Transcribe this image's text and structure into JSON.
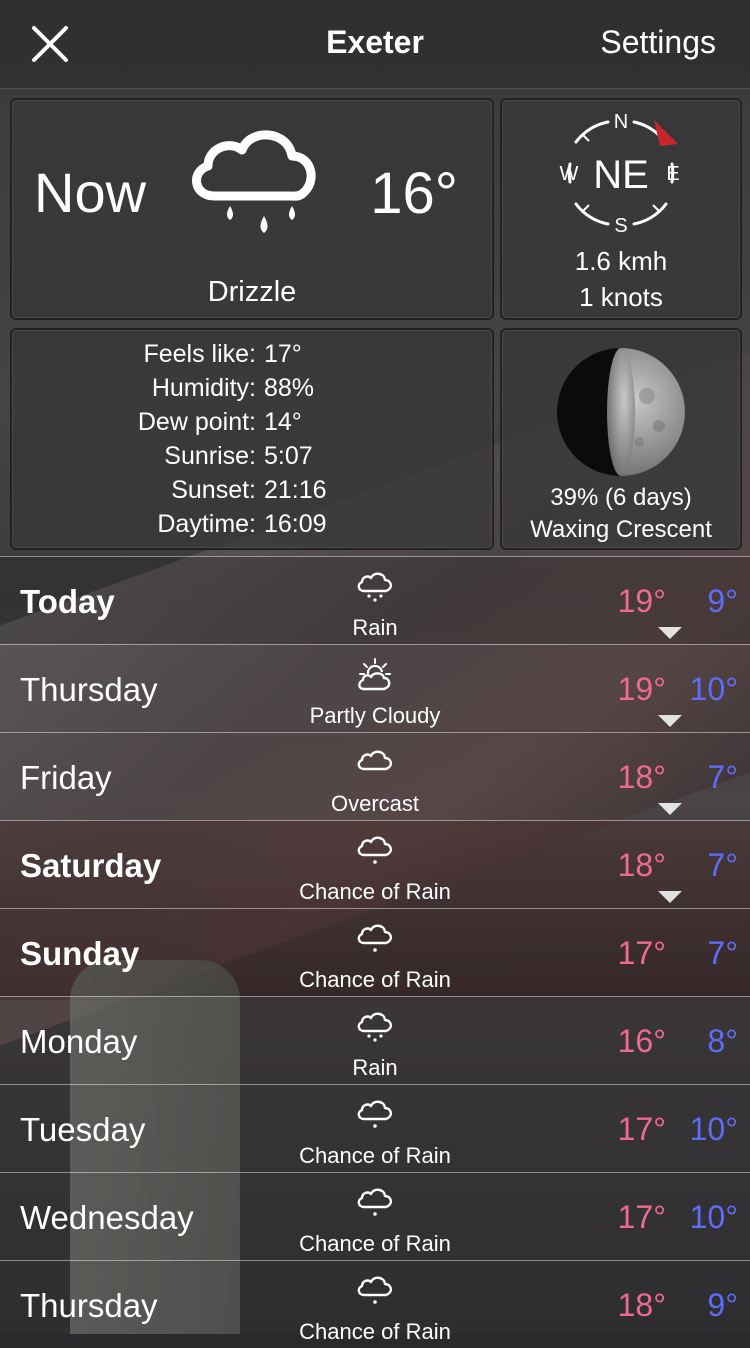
{
  "nav": {
    "title": "Exeter",
    "settings_label": "Settings"
  },
  "current": {
    "label": "Now",
    "temperature": "16°",
    "condition": "Drizzle",
    "icon": "drizzle-cloud-icon"
  },
  "wind": {
    "direction": "NE",
    "compass": {
      "n": "N",
      "e": "E",
      "s": "S",
      "w": "W"
    },
    "speed": "1.6 kmh",
    "knots": "1 knots"
  },
  "details": [
    {
      "label": "Feels like:",
      "value": "17°"
    },
    {
      "label": "Humidity:",
      "value": "88%"
    },
    {
      "label": "Dew point:",
      "value": "14°"
    },
    {
      "label": "Sunrise:",
      "value": "5:07"
    },
    {
      "label": "Sunset:",
      "value": "21:16"
    },
    {
      "label": "Daytime:",
      "value": "16:09"
    }
  ],
  "moon": {
    "percent": "39% (6 days)",
    "phase": "Waxing Crescent"
  },
  "colors": {
    "high_temp": "#ef6a8e",
    "low_temp": "#5f6cf5",
    "wind_arrow": "#c8262a"
  },
  "forecast": [
    {
      "day": "Today",
      "condition": "Rain",
      "icon": "rain-icon",
      "high": "19°",
      "low": "9°"
    },
    {
      "day": "Thursday",
      "condition": "Partly Cloudy",
      "icon": "partly-cloudy-icon",
      "high": "19°",
      "low": "10°"
    },
    {
      "day": "Friday",
      "condition": "Overcast",
      "icon": "overcast-icon",
      "high": "18°",
      "low": "7°"
    },
    {
      "day": "Saturday",
      "condition": "Chance of Rain",
      "icon": "chance-of-rain-icon",
      "high": "18°",
      "low": "7°"
    },
    {
      "day": "Sunday",
      "condition": "Chance of Rain",
      "icon": "chance-of-rain-icon",
      "high": "17°",
      "low": "7°"
    },
    {
      "day": "Monday",
      "condition": "Rain",
      "icon": "rain-icon",
      "high": "16°",
      "low": "8°"
    },
    {
      "day": "Tuesday",
      "condition": "Chance of Rain",
      "icon": "chance-of-rain-icon",
      "high": "17°",
      "low": "10°"
    },
    {
      "day": "Wednesday",
      "condition": "Chance of Rain",
      "icon": "chance-of-rain-icon",
      "high": "17°",
      "low": "10°"
    },
    {
      "day": "Thursday",
      "condition": "Chance of Rain",
      "icon": "chance-of-rain-icon",
      "high": "18°",
      "low": "9°"
    }
  ]
}
